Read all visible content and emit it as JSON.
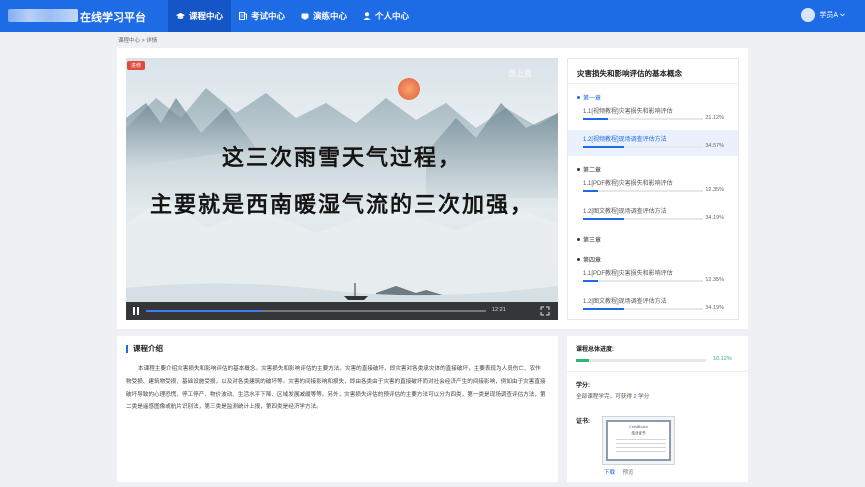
{
  "header": {
    "brand": "在线学习平台",
    "nav": [
      {
        "label": "课程中心",
        "active": true,
        "icon": "graduation-cap-icon"
      },
      {
        "label": "考试中心",
        "active": false,
        "icon": "exam-icon"
      },
      {
        "label": "演练中心",
        "active": false,
        "icon": "practice-icon"
      },
      {
        "label": "个人中心",
        "active": false,
        "icon": "person-icon"
      }
    ],
    "user_name": "学员A"
  },
  "breadcrumb": "课程中心 > 详情",
  "video": {
    "badge": "进修",
    "watermark": "登上我",
    "subtitle_line1": "这三次雨雪天气过程，",
    "subtitle_line2": "主要就是西南暖湿气流的三次加强，",
    "time": "12:21",
    "progress": 0.34
  },
  "chapters": {
    "title": "灾害损失和影响评估的基本概念",
    "groups": [
      {
        "name": "第一章",
        "active": true,
        "lessons": [
          {
            "name": "1.1[视频教程]灾害损失和影响评估",
            "pct": "21.12%",
            "value": 0.2112,
            "active": false
          },
          {
            "name": "1.2[视频教程]现场调查评估方法",
            "pct": "34.57%",
            "value": 0.3457,
            "active": true
          }
        ]
      },
      {
        "name": "第二章",
        "active": false,
        "lessons": [
          {
            "name": "1.1[PDF教程]灾害损失和影响评估",
            "pct": "12.35%",
            "value": 0.1235,
            "active": false
          },
          {
            "name": "1.2[图文教程]现场调查评估方法",
            "pct": "34.19%",
            "value": 0.3419,
            "active": false
          }
        ]
      },
      {
        "name": "第三章",
        "active": false,
        "lessons": []
      },
      {
        "name": "第四章",
        "active": false,
        "lessons": [
          {
            "name": "1.1[PDF教程]灾害损失和影响评估",
            "pct": "12.35%",
            "value": 0.1235,
            "active": false
          },
          {
            "name": "1.2[图文教程]现场调查评估方法",
            "pct": "34.19%",
            "value": 0.3419,
            "active": false
          }
        ]
      }
    ]
  },
  "intro": {
    "title": "课程介绍",
    "text": "本课程主要介绍灾害损失和影响评估的基本概念。灾害损失和影响评估的主要方法。灾害的直接破坏，即灾害对各类承灾体的直接破坏，主要表现为人员伤亡、农作物受损、建筑物受损、基础设施受损，以及对各类建筑的破坏等。灾害的间接影响和损失，即由各类由于灾害的直接破坏而对社会经济产生的间接影响，例如由于灾害直接破坏导致的心理恐慌、停工停产、物价波动、生活水平下降、区域发展减缓等等。另外，灾害损失评估的预评估的主要方法可以分为四类，第一类是现场调查评估方法，第二类是遥感图像或航片识别法，第三类是监测统计上报，第四类是经济学方法。"
  },
  "progress": {
    "label": "课程总体进度:",
    "pct": "10.12%",
    "value": 0.1012,
    "credit_label": "学分:",
    "credit_prefix": "全部课程学完，可获得 ",
    "credit_num": "2",
    "credit_suffix": " 学分",
    "cert_label": "证书:",
    "cert_line1": "Certificate",
    "cert_line2": "结业证书",
    "download": "下载",
    "preview": "预览"
  },
  "colors": {
    "primary": "#1e6be6",
    "success": "#2eb872",
    "live": "#e34b3f"
  }
}
